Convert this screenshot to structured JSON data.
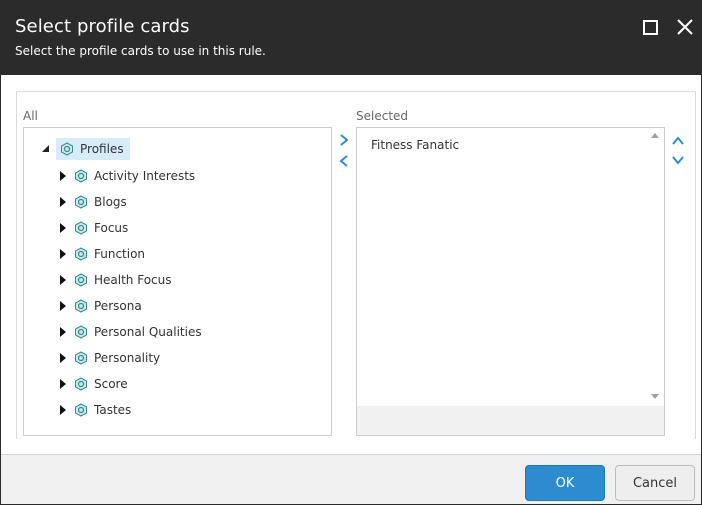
{
  "dialog": {
    "title": "Select profile cards",
    "subtitle": "Select the profile cards to use in this rule."
  },
  "labels": {
    "all": "All",
    "selected": "Selected"
  },
  "tree": {
    "root": "Profiles",
    "items": [
      "Activity Interests",
      "Blogs",
      "Focus",
      "Function",
      "Health Focus",
      "Persona",
      "Personal Qualities",
      "Personality",
      "Score",
      "Tastes"
    ]
  },
  "selected_items": [
    "Fitness Fanatic"
  ],
  "buttons": {
    "ok": "OK",
    "cancel": "Cancel"
  },
  "colors": {
    "header": "#2b2b2b",
    "accent": "#2c8ccf",
    "root_highlight": "#d6ecf8"
  },
  "icons": [
    "maximize-icon",
    "close-icon",
    "profile-card-icon",
    "chevron-right-icon",
    "chevron-left-icon",
    "chevron-up-icon",
    "chevron-down-icon"
  ]
}
